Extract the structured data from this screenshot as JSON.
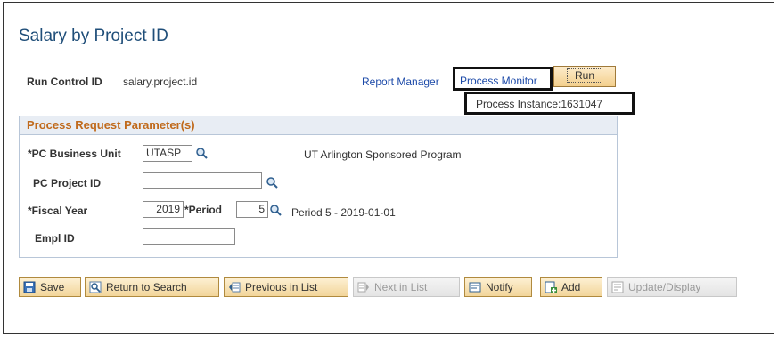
{
  "page": {
    "title": "Salary by Project ID",
    "run_control_label": "Run Control ID",
    "run_control_value": "salary.project.id"
  },
  "links": {
    "report_manager": "Report Manager",
    "process_monitor": "Process Monitor"
  },
  "run_button": "Run",
  "process_instance": "Process Instance:1631047",
  "group": {
    "title": "Process Request Parameter(s)"
  },
  "fields": {
    "business_unit": {
      "label": "*PC Business Unit",
      "value": "UTASP",
      "description": "UT Arlington Sponsored Program"
    },
    "project_id": {
      "label": "PC Project ID",
      "value": ""
    },
    "fiscal_year": {
      "label": "*Fiscal Year",
      "value": "2019"
    },
    "period": {
      "label": "*Period",
      "value": "5",
      "description": "Period 5 - 2019-01-01"
    },
    "empl_id": {
      "label": "Empl ID",
      "value": ""
    }
  },
  "toolbar": {
    "save": "Save",
    "return_to_search": "Return to Search",
    "previous_in_list": "Previous in List",
    "next_in_list": "Next in List",
    "notify": "Notify",
    "add": "Add",
    "update_display": "Update/Display"
  },
  "colors": {
    "title": "#1f4e79",
    "link": "#1b49a8",
    "group_title": "#c06a1c",
    "button_bg": "#f2d59a"
  }
}
